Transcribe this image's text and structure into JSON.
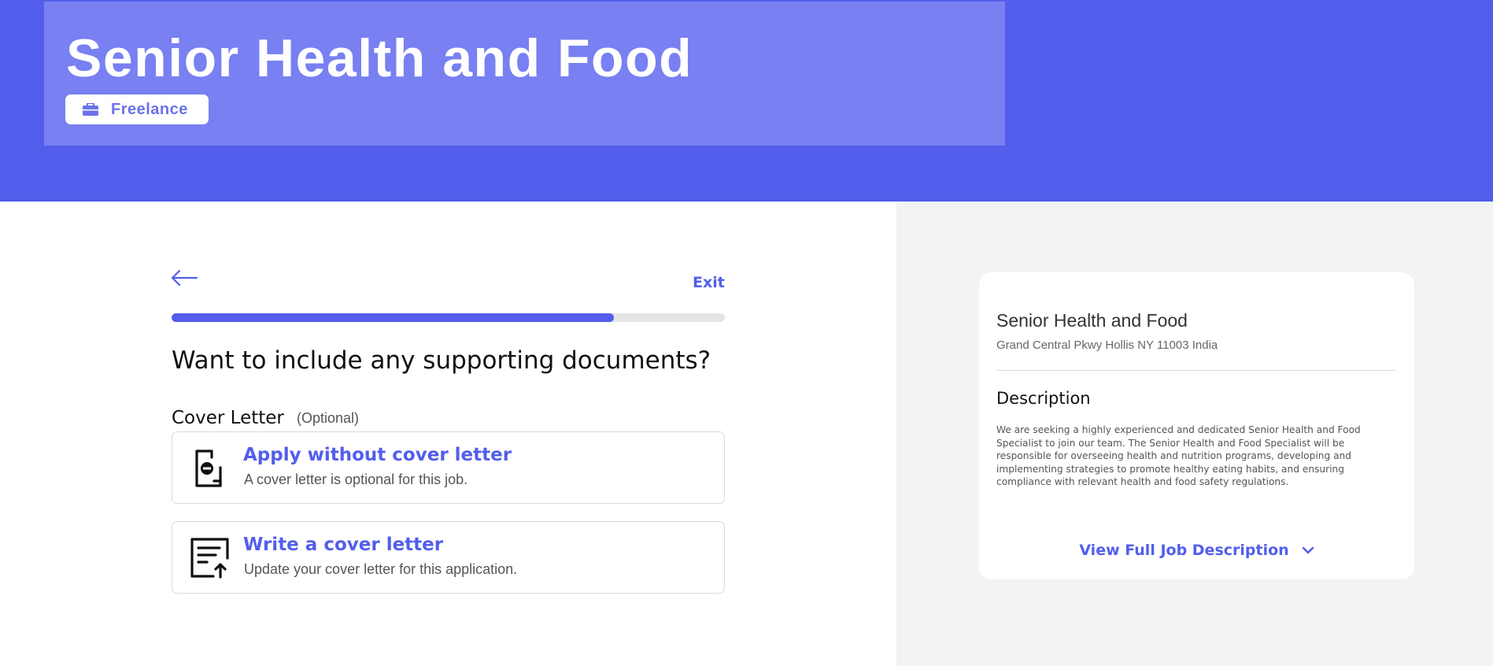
{
  "header": {
    "job_title": "Senior Health and Food",
    "job_type": "Freelance",
    "job_type_icon": "briefcase-icon"
  },
  "application": {
    "back_icon": "arrow-left-icon",
    "exit_label": "Exit",
    "progress_fraction": 0.8,
    "question": "Want to include any supporting documents?",
    "cover_letter_label": "Cover Letter",
    "cover_letter_optional": "(Optional)",
    "options": [
      {
        "icon": "document-minus-icon",
        "title": "Apply without cover letter",
        "subtitle": "A cover letter is optional for this job."
      },
      {
        "icon": "document-upload-icon",
        "title": "Write a cover letter",
        "subtitle": "Update your cover letter for this application."
      }
    ]
  },
  "job_summary": {
    "title": "Senior Health and Food",
    "address": "Grand Central Pkwy Hollis NY 11003 India",
    "description_heading": "Description",
    "description": "We are seeking a highly experienced and dedicated Senior Health and Food Specialist to join our team. The Senior Health and Food Specialist will be responsible for overseeing health and nutrition programs, developing and implementing strategies to promote healthy eating habits, and ensuring compliance with relevant health and food safety regulations.",
    "view_full_label": "View Full Job Description",
    "view_full_icon": "chevron-down-icon"
  },
  "colors": {
    "brand": "#525eeb",
    "header_card": "#7880f2",
    "panel_bg": "#f2f3f5"
  }
}
